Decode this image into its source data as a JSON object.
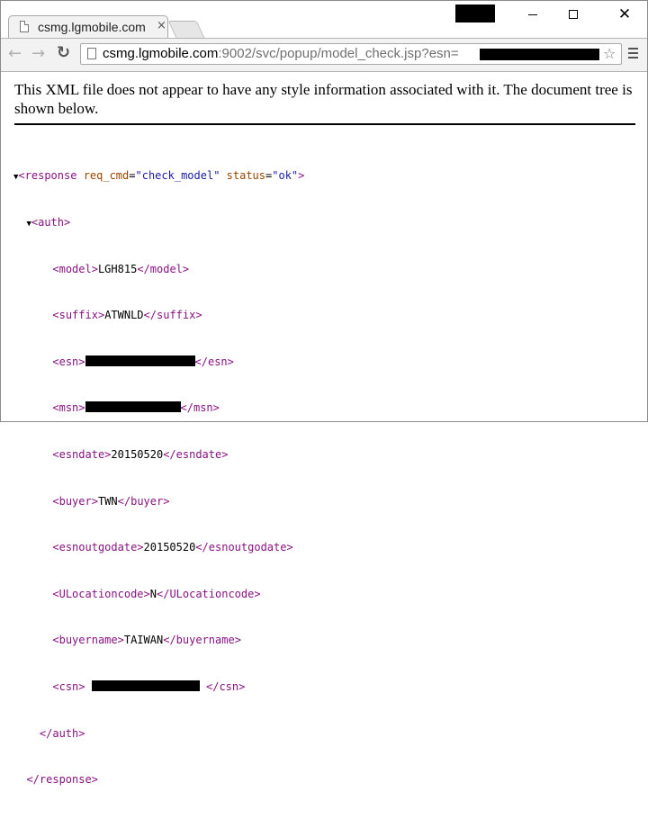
{
  "browser": {
    "tab_title": "csmg.lgmobile.com",
    "tab_close": "×",
    "url_host": "csmg.lgmobile.com",
    "url_rest": ":9002/svc/popup/model_check.jsp?esn=",
    "win_close": "✕"
  },
  "icons": {
    "back": "arrow-left-icon",
    "forward": "arrow-right-icon",
    "reload": "reload-icon",
    "star": "star-icon",
    "menu": "hamburger-menu-icon",
    "page": "page-icon"
  },
  "page": {
    "info_text": "This XML file does not appear to have any style information associated with it. The document tree is shown below."
  },
  "xml": {
    "tri": "▼",
    "lt": "<",
    "lt_close": "</",
    "gt": ">",
    "eq": "=",
    "response_tag": "response",
    "attr1_name": "req_cmd",
    "attr1_value": "\"check_model\"",
    "attr2_name": "status",
    "attr2_value": "\"ok\"",
    "auth_tag": "auth",
    "model_tag": "model",
    "model_value": "LGH815",
    "suffix_tag": "suffix",
    "suffix_value": "ATWNLD",
    "esn_tag": "esn",
    "msn_tag": "msn",
    "esndate_tag": "esndate",
    "esndate_value": "20150520",
    "buyer_tag": "buyer",
    "buyer_value": "TWN",
    "esnoutgodate_tag": "esnoutgodate",
    "esnoutgodate_value": "20150520",
    "ulocationcode_tag": "ULocationcode",
    "ulocationcode_value": "N",
    "buyername_tag": "buyername",
    "buyername_value": "TAIWAN",
    "csn_tag": "csn"
  }
}
